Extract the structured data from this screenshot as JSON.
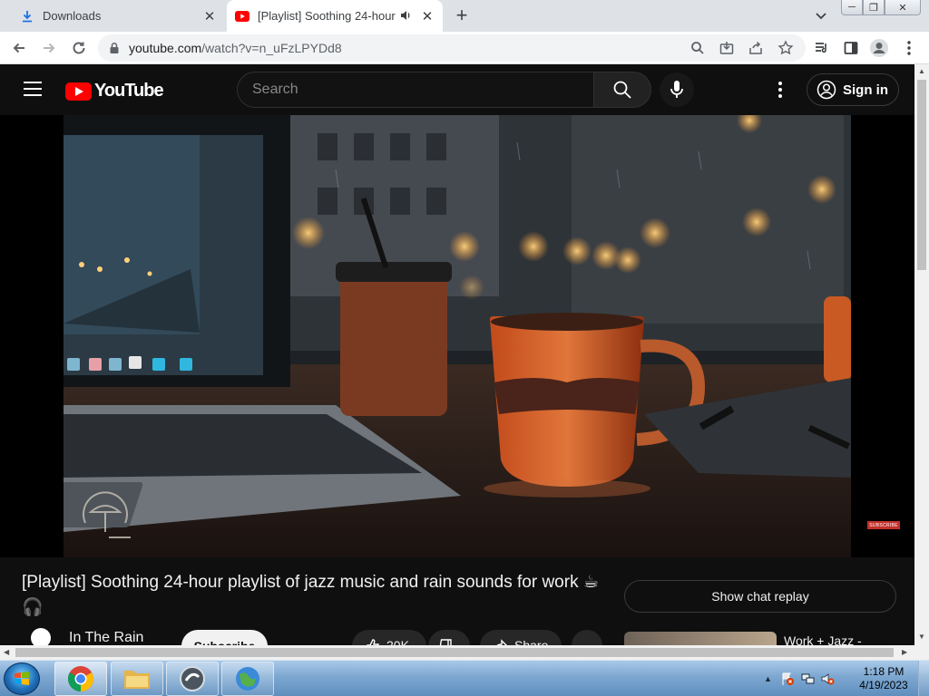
{
  "browser": {
    "tabs": [
      {
        "title": "Downloads",
        "favicon": "download-icon"
      },
      {
        "title": "[Playlist] Soothing 24-hour p",
        "favicon": "youtube-icon",
        "audio": true
      }
    ],
    "url_host": "youtube.com",
    "url_path": "/watch?v=n_uFzLPYDd8"
  },
  "youtube": {
    "logo_text": "YouTube",
    "search_placeholder": "Search",
    "signin_label": "Sign in",
    "video_title": "[Playlist] Soothing 24-hour playlist of jazz music and rain sounds for work ☕ 🎧",
    "subscribe_watermark": "SUBSCRIBE",
    "show_chat_replay": "Show chat replay",
    "channel_name": "In The Rain",
    "subscribe_label": "Subscribe",
    "like_count": "20K",
    "share_label": "Share",
    "next_video_title": "Work + Jazz -"
  },
  "taskbar": {
    "time": "1:18 PM",
    "date": "4/19/2023"
  },
  "colors": {
    "yt_bg": "#0f0f0f",
    "yt_red": "#ff0000",
    "chrome_tabstrip": "#dee1e6"
  }
}
